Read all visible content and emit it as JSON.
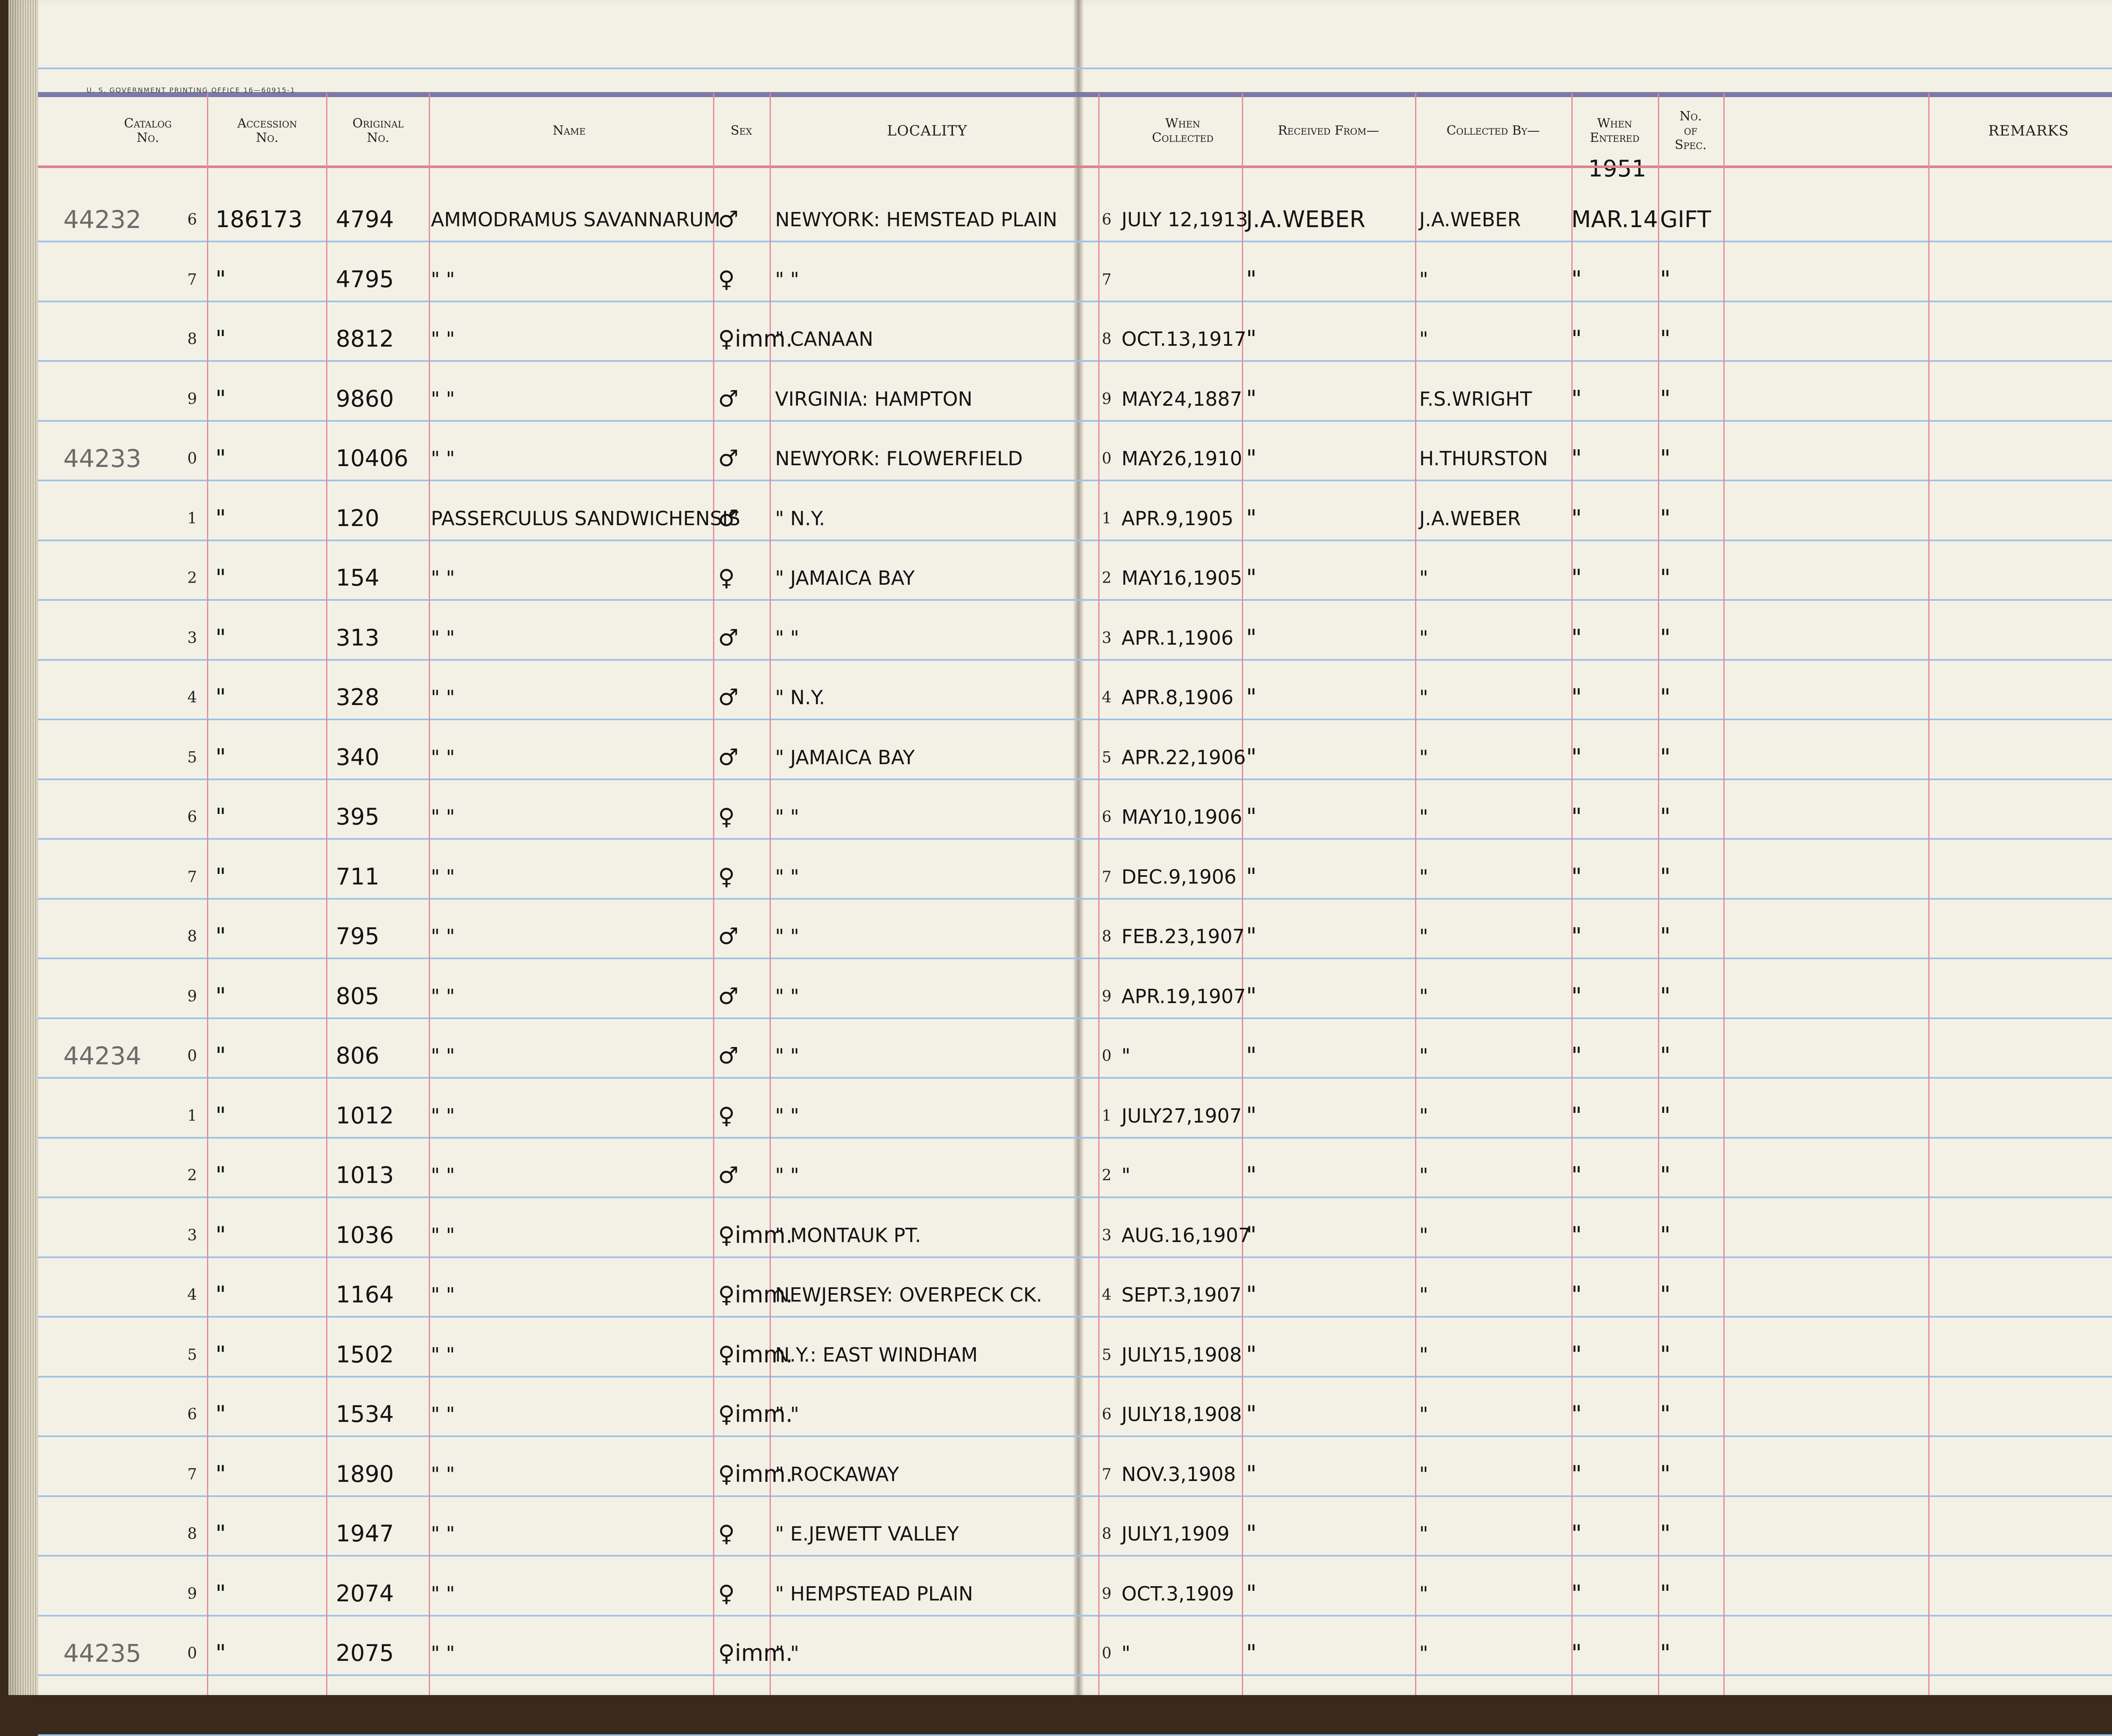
{
  "print_note": "U. S. GOVERNMENT PRINTING OFFICE   16—60915-1",
  "headers": {
    "catalog": "Catalog\nNo.",
    "accession": "Accession\nNo.",
    "original": "Original\nNo.",
    "name": "Name",
    "sex": "Sex",
    "locality": "LOCALITY",
    "when_collected": "When\nCollected",
    "received_from": "Received From—",
    "collected_by": "Collected By—",
    "when_entered": "When\nEntered",
    "no_of_spec": "No.\nof\nSpec.",
    "remarks": "REMARKS"
  },
  "entered_year": "1951",
  "rows": [
    {
      "catalog": "44232",
      "num": "6",
      "accession": "186173",
      "original": "4794",
      "name": "AMMODRAMUS SAVANNARUM",
      "sex": "♂",
      "locality": "NEWYORK: HEMSTEAD PLAIN",
      "rnum": "6",
      "date": "JULY 12,1913",
      "received": "J.A.WEBER",
      "collected": "J.A.WEBER",
      "entered": "MAR.14",
      "spec": "GIFT"
    },
    {
      "catalog": "",
      "num": "7",
      "accession": "\"",
      "original": "4795",
      "name": "\"        \"",
      "sex": "♀",
      "locality": "\"        \"",
      "rnum": "7",
      "date": "",
      "received": "\"",
      "collected": "\"",
      "entered": "\"",
      "spec": "\""
    },
    {
      "catalog": "",
      "num": "8",
      "accession": "\"",
      "original": "8812",
      "name": "\"        \"",
      "sex": "♀imm.",
      "locality": "\"    CANAAN",
      "rnum": "8",
      "date": "OCT.13,1917",
      "received": "\"",
      "collected": "\"",
      "entered": "\"",
      "spec": "\""
    },
    {
      "catalog": "",
      "num": "9",
      "accession": "\"",
      "original": "9860",
      "name": "\"        \"",
      "sex": "♂",
      "locality": "VIRGINIA: HAMPTON",
      "rnum": "9",
      "date": "MAY24,1887",
      "received": "\"",
      "collected": "F.S.WRIGHT",
      "entered": "\"",
      "spec": "\""
    },
    {
      "catalog": "44233",
      "num": "0",
      "accession": "\"",
      "original": "10406",
      "name": "\"        \"",
      "sex": "♂",
      "locality": "NEWYORK: FLOWERFIELD",
      "rnum": "0",
      "date": "MAY26,1910",
      "received": "\"",
      "collected": "H.THURSTON",
      "entered": "\"",
      "spec": "\""
    },
    {
      "catalog": "",
      "num": "1",
      "accession": "\"",
      "original": "120",
      "name": "PASSERCULUS SANDWICHENSIS",
      "sex": "♂",
      "locality": "\"      N.Y.",
      "rnum": "1",
      "date": "APR.9,1905",
      "received": "\"",
      "collected": "J.A.WEBER",
      "entered": "\"",
      "spec": "\""
    },
    {
      "catalog": "",
      "num": "2",
      "accession": "\"",
      "original": "154",
      "name": "\"        \"",
      "sex": "♀",
      "locality": "\"   JAMAICA BAY",
      "rnum": "2",
      "date": "MAY16,1905",
      "received": "\"",
      "collected": "\"",
      "entered": "\"",
      "spec": "\""
    },
    {
      "catalog": "",
      "num": "3",
      "accession": "\"",
      "original": "313",
      "name": "\"        \"",
      "sex": "♂",
      "locality": "\"        \"",
      "rnum": "3",
      "date": "APR.1,1906",
      "received": "\"",
      "collected": "\"",
      "entered": "\"",
      "spec": "\""
    },
    {
      "catalog": "",
      "num": "4",
      "accession": "\"",
      "original": "328",
      "name": "\"        \"",
      "sex": "♂",
      "locality": "\"      N.Y.",
      "rnum": "4",
      "date": "APR.8,1906",
      "received": "\"",
      "collected": "\"",
      "entered": "\"",
      "spec": "\""
    },
    {
      "catalog": "",
      "num": "5",
      "accession": "\"",
      "original": "340",
      "name": "\"        \"",
      "sex": "♂",
      "locality": "\"   JAMAICA BAY",
      "rnum": "5",
      "date": "APR.22,1906",
      "received": "\"",
      "collected": "\"",
      "entered": "\"",
      "spec": "\""
    },
    {
      "catalog": "",
      "num": "6",
      "accession": "\"",
      "original": "395",
      "name": "\"        \"",
      "sex": "♀",
      "locality": "\"        \"",
      "rnum": "6",
      "date": "MAY10,1906",
      "received": "\"",
      "collected": "\"",
      "entered": "\"",
      "spec": "\""
    },
    {
      "catalog": "",
      "num": "7",
      "accession": "\"",
      "original": "711",
      "name": "\"        \"",
      "sex": "♀",
      "locality": "\"        \"",
      "rnum": "7",
      "date": "DEC.9,1906",
      "received": "\"",
      "collected": "\"",
      "entered": "\"",
      "spec": "\""
    },
    {
      "catalog": "",
      "num": "8",
      "accession": "\"",
      "original": "795",
      "name": "\"        \"",
      "sex": "♂",
      "locality": "\"        \"",
      "rnum": "8",
      "date": "FEB.23,1907",
      "received": "\"",
      "collected": "\"",
      "entered": "\"",
      "spec": "\""
    },
    {
      "catalog": "",
      "num": "9",
      "accession": "\"",
      "original": "805",
      "name": "\"        \"",
      "sex": "♂",
      "locality": "\"        \"",
      "rnum": "9",
      "date": "APR.19,1907",
      "received": "\"",
      "collected": "\"",
      "entered": "\"",
      "spec": "\""
    },
    {
      "catalog": "44234",
      "num": "0",
      "accession": "\"",
      "original": "806",
      "name": "\"        \"",
      "sex": "♂",
      "locality": "\"        \"",
      "rnum": "0",
      "date": "\"",
      "received": "\"",
      "collected": "\"",
      "entered": "\"",
      "spec": "\""
    },
    {
      "catalog": "",
      "num": "1",
      "accession": "\"",
      "original": "1012",
      "name": "\"        \"",
      "sex": "♀",
      "locality": "\"        \"",
      "rnum": "1",
      "date": "JULY27,1907",
      "received": "\"",
      "collected": "\"",
      "entered": "\"",
      "spec": "\""
    },
    {
      "catalog": "",
      "num": "2",
      "accession": "\"",
      "original": "1013",
      "name": "\"        \"",
      "sex": "♂",
      "locality": "\"        \"",
      "rnum": "2",
      "date": "\"",
      "received": "\"",
      "collected": "\"",
      "entered": "\"",
      "spec": "\""
    },
    {
      "catalog": "",
      "num": "3",
      "accession": "\"",
      "original": "1036",
      "name": "\"        \"",
      "sex": "♀imm.",
      "locality": "\"   MONTAUK PT.",
      "rnum": "3",
      "date": "AUG.16,1907",
      "received": "\"",
      "collected": "\"",
      "entered": "\"",
      "spec": "\""
    },
    {
      "catalog": "",
      "num": "4",
      "accession": "\"",
      "original": "1164",
      "name": "\"        \"",
      "sex": "♀imm.",
      "locality": "NEWJERSEY: OVERPECK CK.",
      "rnum": "4",
      "date": "SEPT.3,1907",
      "received": "\"",
      "collected": "\"",
      "entered": "\"",
      "spec": "\""
    },
    {
      "catalog": "",
      "num": "5",
      "accession": "\"",
      "original": "1502",
      "name": "\"        \"",
      "sex": "♀imm.",
      "locality": "N.Y.: EAST WINDHAM",
      "rnum": "5",
      "date": "JULY15,1908",
      "received": "\"",
      "collected": "\"",
      "entered": "\"",
      "spec": "\""
    },
    {
      "catalog": "",
      "num": "6",
      "accession": "\"",
      "original": "1534",
      "name": "\"        \"",
      "sex": "♀imm.",
      "locality": "\"        \"",
      "rnum": "6",
      "date": "JULY18,1908",
      "received": "\"",
      "collected": "\"",
      "entered": "\"",
      "spec": "\""
    },
    {
      "catalog": "",
      "num": "7",
      "accession": "\"",
      "original": "1890",
      "name": "\"        \"",
      "sex": "♀imm.",
      "locality": "\"   ROCKAWAY",
      "rnum": "7",
      "date": "NOV.3,1908",
      "received": "\"",
      "collected": "\"",
      "entered": "\"",
      "spec": "\""
    },
    {
      "catalog": "",
      "num": "8",
      "accession": "\"",
      "original": "1947",
      "name": "\"        \"",
      "sex": "♀",
      "locality": "\"  E.JEWETT VALLEY",
      "rnum": "8",
      "date": "JULY1,1909",
      "received": "\"",
      "collected": "\"",
      "entered": "\"",
      "spec": "\""
    },
    {
      "catalog": "",
      "num": "9",
      "accession": "\"",
      "original": "2074",
      "name": "\"        \"",
      "sex": "♀",
      "locality": "\"  HEMPSTEAD PLAIN",
      "rnum": "9",
      "date": "OCT.3,1909",
      "received": "\"",
      "collected": "\"",
      "entered": "\"",
      "spec": "\""
    },
    {
      "catalog": "44235",
      "num": "0",
      "accession": "\"",
      "original": "2075",
      "name": "\"        \"",
      "sex": "♀imm.",
      "locality": "\"        \"",
      "rnum": "0",
      "date": "\"",
      "received": "\"",
      "collected": "\"",
      "entered": "\"",
      "spec": "\""
    }
  ]
}
